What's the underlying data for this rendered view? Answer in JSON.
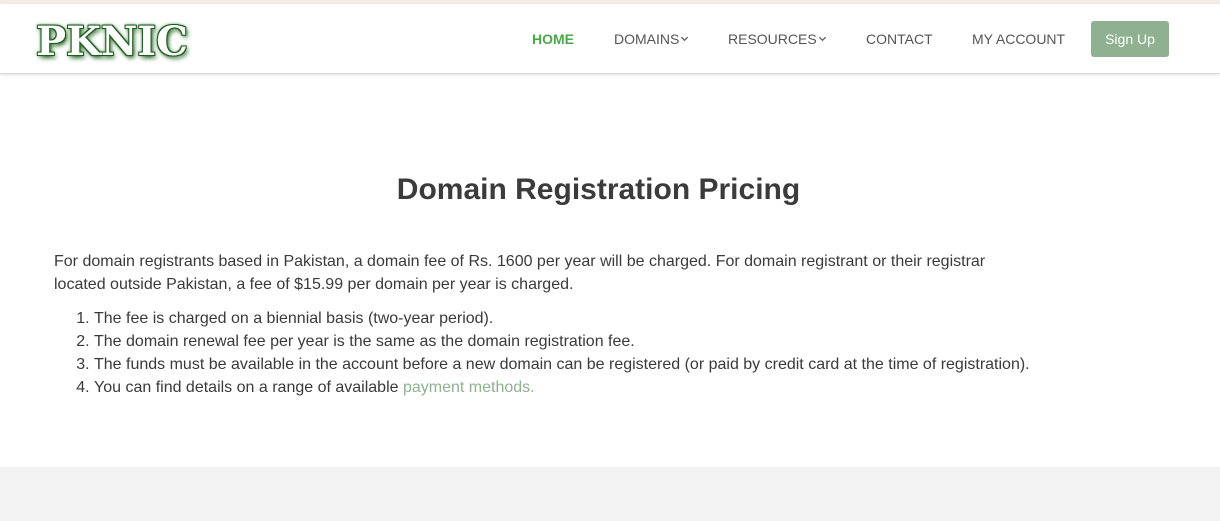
{
  "header": {
    "logo_text": "PKNIC",
    "nav": [
      {
        "label": "HOME",
        "active": true
      },
      {
        "label": "DOMAINS",
        "dropdown": true
      },
      {
        "label": "RESOURCES",
        "dropdown": true
      },
      {
        "label": "CONTACT"
      },
      {
        "label": "MY ACCOUNT"
      }
    ],
    "signup_label": "Sign Up"
  },
  "main": {
    "title": "Domain Registration Pricing",
    "intro": "For domain registrants based in Pakistan, a domain fee of Rs. 1600 per year will be charged. For domain registrant or their registrar located outside Pakistan, a fee of $15.99 per domain per year is charged.",
    "list": [
      "The fee is charged on a biennial basis (two-year period).",
      "The domain renewal fee per year is the same as the domain registration fee.",
      "The funds must be available in the account before a new domain can be registered (or paid by credit card at the time of registration).",
      "You can find details on a range of available "
    ],
    "link_text": "payment methods."
  },
  "colors": {
    "accent_green": "#4aa84a",
    "button_green": "#8fb091",
    "link_green": "#8fb091",
    "text": "#3a3a3a",
    "footer_bg": "#f3f3f3"
  },
  "icons": {
    "dropdown": "chevron-down-icon"
  }
}
